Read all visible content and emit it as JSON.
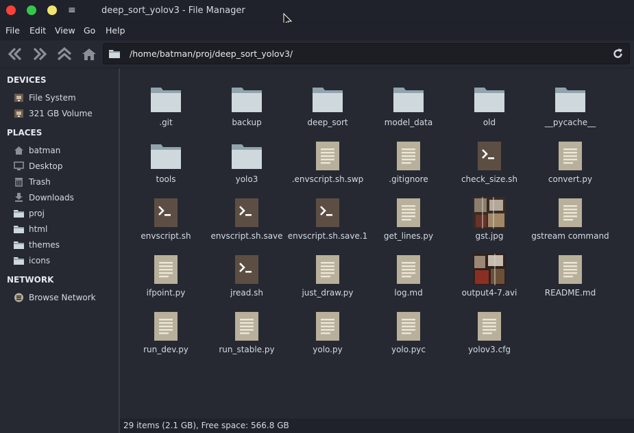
{
  "window": {
    "title": "deep_sort_yolov3 - File Manager",
    "menu_glyph": "≡"
  },
  "menubar": [
    "File",
    "Edit",
    "View",
    "Go",
    "Help"
  ],
  "pathbar": {
    "path": "/home/batman/proj/deep_sort_yolov3/"
  },
  "sidebar": {
    "sections": [
      {
        "title": "DEVICES",
        "items": [
          {
            "label": "File System",
            "icon": "drive-icon"
          },
          {
            "label": "321 GB Volume",
            "icon": "drive-icon"
          }
        ]
      },
      {
        "title": "PLACES",
        "items": [
          {
            "label": "batman",
            "icon": "home-icon"
          },
          {
            "label": "Desktop",
            "icon": "desktop-icon"
          },
          {
            "label": "Trash",
            "icon": "trash-icon"
          },
          {
            "label": "Downloads",
            "icon": "download-icon"
          },
          {
            "label": "proj",
            "icon": "folder-icon"
          },
          {
            "label": "html",
            "icon": "folder-icon"
          },
          {
            "label": "themes",
            "icon": "folder-icon"
          },
          {
            "label": "icons",
            "icon": "folder-icon"
          }
        ]
      },
      {
        "title": "NETWORK",
        "items": [
          {
            "label": "Browse Network",
            "icon": "network-icon"
          }
        ]
      }
    ]
  },
  "files": [
    {
      "name": ".git",
      "type": "folder"
    },
    {
      "name": "backup",
      "type": "folder"
    },
    {
      "name": "deep_sort",
      "type": "folder"
    },
    {
      "name": "model_data",
      "type": "folder"
    },
    {
      "name": "old",
      "type": "folder"
    },
    {
      "name": "__pycache__",
      "type": "folder"
    },
    {
      "name": "tools",
      "type": "folder"
    },
    {
      "name": "yolo3",
      "type": "folder"
    },
    {
      "name": ".envscript.sh.swp",
      "type": "text"
    },
    {
      "name": ".gitignore",
      "type": "text"
    },
    {
      "name": "check_size.sh",
      "type": "script"
    },
    {
      "name": "convert.py",
      "type": "text"
    },
    {
      "name": "envscript.sh",
      "type": "script"
    },
    {
      "name": "envscript.sh.save",
      "type": "script"
    },
    {
      "name": "envscript.sh.save.1",
      "type": "script"
    },
    {
      "name": "get_lines.py",
      "type": "text"
    },
    {
      "name": "gst.jpg",
      "type": "image"
    },
    {
      "name": "gstream command",
      "type": "text"
    },
    {
      "name": "ifpoint.py",
      "type": "text"
    },
    {
      "name": "jread.sh",
      "type": "script"
    },
    {
      "name": "just_draw.py",
      "type": "text"
    },
    {
      "name": "log.md",
      "type": "text"
    },
    {
      "name": "output4-7.avi",
      "type": "video"
    },
    {
      "name": "README.md",
      "type": "text"
    },
    {
      "name": "run_dev.py",
      "type": "text"
    },
    {
      "name": "run_stable.py",
      "type": "text"
    },
    {
      "name": "yolo.py",
      "type": "text"
    },
    {
      "name": "yolo.pyc",
      "type": "text"
    },
    {
      "name": "yolov3.cfg",
      "type": "text"
    }
  ],
  "status": {
    "text": "29 items (2.1 GB), Free space: 566.8 GB"
  },
  "colors": {
    "accent_close": "#fc4138",
    "accent_max": "#34c84a",
    "accent_min": "#f2e56f",
    "folder": "#cfd8dc",
    "folder_tab": "#90a4ae",
    "script_bg": "#5d4e44",
    "text_file": "#b8b09a"
  }
}
